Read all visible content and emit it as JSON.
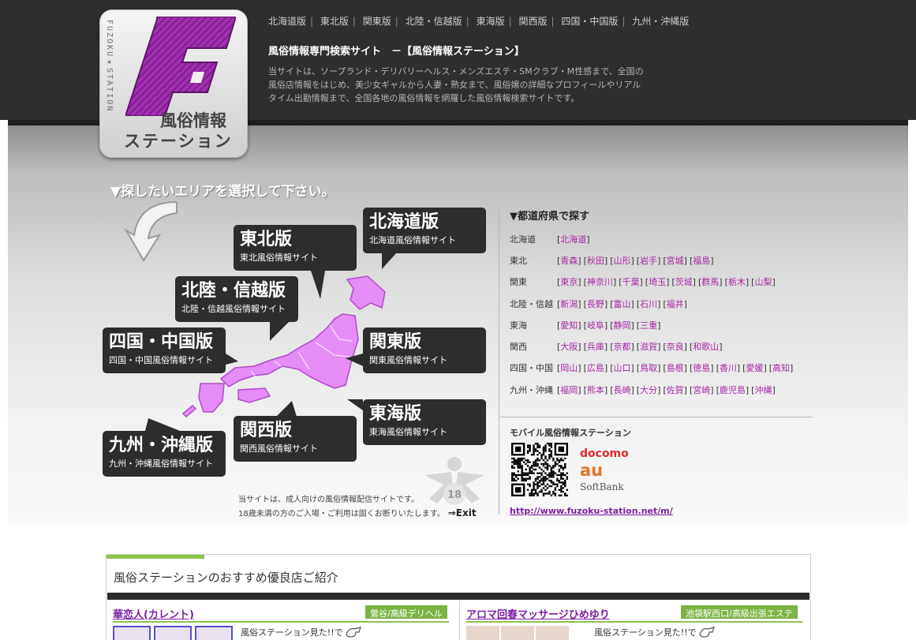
{
  "header": {
    "region_links": [
      "北海道版",
      "東北版",
      "関東版",
      "北陸・信越版",
      "東海版",
      "関西版",
      "四国・中国版",
      "九州・沖縄版"
    ],
    "site_title": "風俗情報専門検索サイト　－【風俗情報ステーション】",
    "description": "当サイトは、ソープランド・デリバリーヘルス・メンズエステ・SMクラブ・M性感まで、全国の風俗店情報をはじめ、美少女ギャルから人妻・熟女まで、風俗嬢の詳細なプロフィールやリアルタイム出勤情報まで、全国各地の風俗情報を網羅した風俗情報検索サイトです。"
  },
  "logo": {
    "vertical_text": "FUZOKU★STATION",
    "title_line1": "風俗情報",
    "title_line2": "ステーション",
    "accent_color": "#9b27a8"
  },
  "map": {
    "heading": "▼探したいエリアを選択して下さい。",
    "map_color": "#e58cf7",
    "regions": [
      {
        "key": "hokkaido",
        "title": "北海道版",
        "sub": "北海道風俗情報サイト"
      },
      {
        "key": "tohoku",
        "title": "東北版",
        "sub": "東北風俗情報サイト"
      },
      {
        "key": "hokuriku",
        "title": "北陸・信越版",
        "sub": "北陸・信越風俗情報サイト"
      },
      {
        "key": "shikoku",
        "title": "四国・中国版",
        "sub": "四国・中国風俗情報サイト"
      },
      {
        "key": "kanto",
        "title": "関東版",
        "sub": "関東風俗情報サイト"
      },
      {
        "key": "tokai",
        "title": "東海版",
        "sub": "東海風俗情報サイト"
      },
      {
        "key": "kansai",
        "title": "関西版",
        "sub": "関西風俗情報サイト"
      },
      {
        "key": "kyushu",
        "title": "九州・沖縄版",
        "sub": "九州・沖縄風俗情報サイト"
      }
    ],
    "notice_line1": "当サイトは、成人向けの風俗情報配信サイトです。",
    "notice_line2": "18歳未満の方のご入場・ご利用は固くお断りいたします。",
    "exit_label": "⇒Exit",
    "age_label": "18"
  },
  "prefectures": {
    "heading": "▼都道府県で探す",
    "rows": [
      {
        "region": "北海道",
        "items": [
          "北海道"
        ]
      },
      {
        "region": "東北",
        "items": [
          "青森",
          "秋田",
          "山形",
          "岩手",
          "宮城",
          "福島"
        ]
      },
      {
        "region": "関東",
        "items": [
          "東京",
          "神奈川",
          "千葉",
          "埼玉",
          "茨城",
          "群馬",
          "栃木",
          "山梨"
        ]
      },
      {
        "region": "北陸・信越",
        "items": [
          "新潟",
          "長野",
          "富山",
          "石川",
          "福井"
        ]
      },
      {
        "region": "東海",
        "items": [
          "愛知",
          "岐阜",
          "静岡",
          "三重"
        ]
      },
      {
        "region": "関西",
        "items": [
          "大阪",
          "兵庫",
          "京都",
          "滋賀",
          "奈良",
          "和歌山"
        ]
      },
      {
        "region": "四国・中国",
        "items": [
          "岡山",
          "広島",
          "山口",
          "鳥取",
          "島根",
          "徳島",
          "香川",
          "愛媛",
          "高知"
        ]
      },
      {
        "region": "九州・沖縄",
        "items": [
          "福岡",
          "熊本",
          "長崎",
          "大分",
          "佐賀",
          "宮崎",
          "鹿児島",
          "沖縄"
        ]
      }
    ]
  },
  "mobile": {
    "heading": "モバイル風俗情報ステーション",
    "carriers": [
      "docomo",
      "au",
      "SoftBank"
    ],
    "url": "http://www.fuzoku-station.net/m/"
  },
  "recommend": {
    "title": "風俗ステーションのおすすめ優良店ご紹介",
    "shops": [
      {
        "name": "華恋人(カレント)",
        "category": "鶯谷/高級デリヘル",
        "text": "風俗ステーション見た!!で"
      },
      {
        "name": "アロマ回春マッサージひめゆり",
        "category": "池袋駅西口/高級出張エステ",
        "text": "風俗ステーション見た!!で"
      }
    ]
  }
}
